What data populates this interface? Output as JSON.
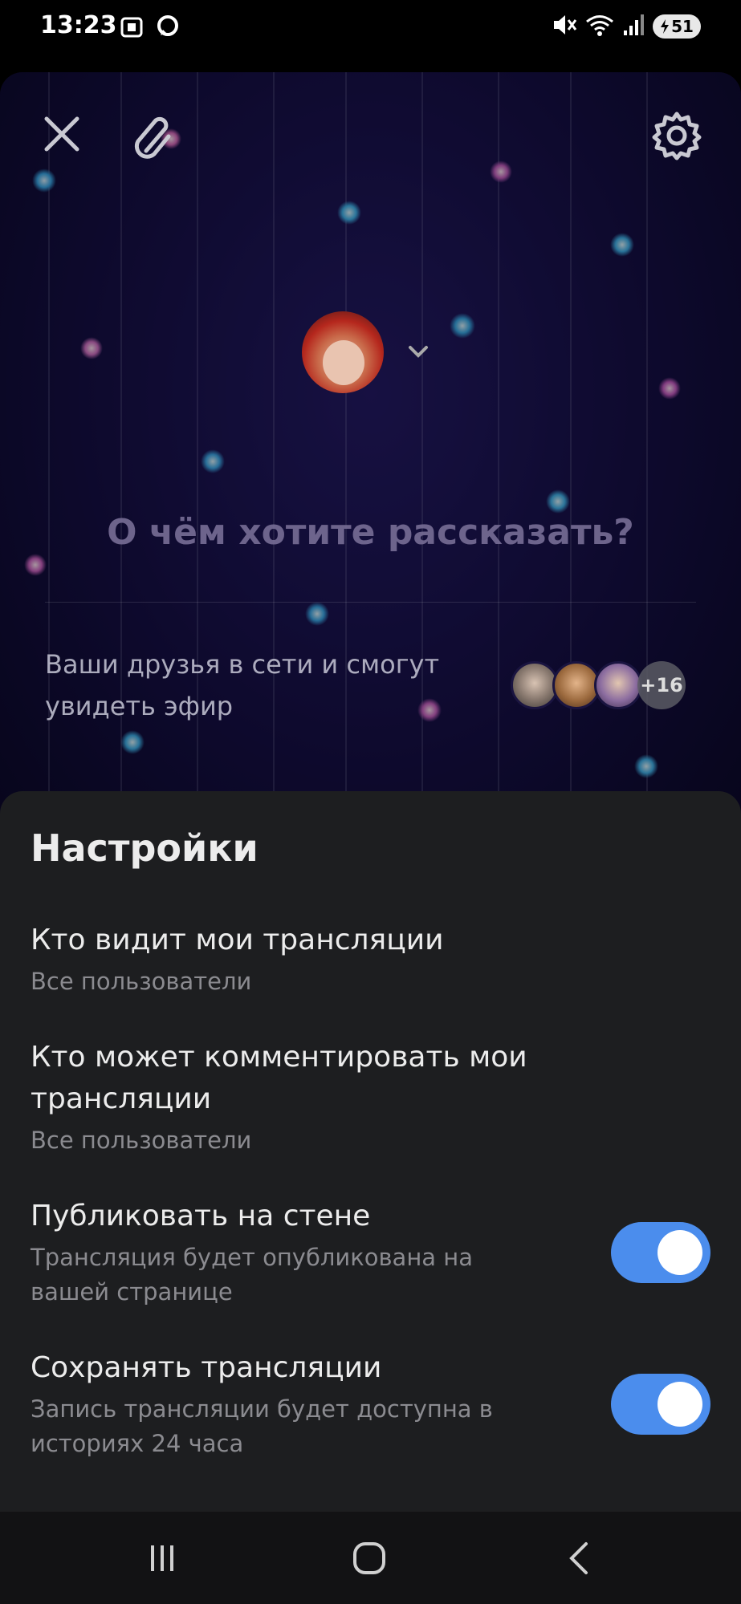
{
  "status_bar": {
    "time": "13:23",
    "battery": "51",
    "icons": [
      "screenshot-icon",
      "messenger-icon",
      "mute-icon",
      "wifi-icon",
      "signal-icon",
      "battery-icon"
    ]
  },
  "composer": {
    "placeholder": "О чём хотите рассказать?",
    "friends_text": "Ваши друзья в сети и смогут увидеть эфир",
    "friends_more": "+16",
    "icons": [
      "close-icon",
      "attach-icon",
      "settings-icon",
      "chevron-down-icon"
    ]
  },
  "settings": {
    "title": "Настройки",
    "options": [
      {
        "title": "Кто видит мои трансляции",
        "subtitle": "Все пользователи"
      },
      {
        "title": "Кто может комментировать мои трансляции",
        "subtitle": "Все пользователи"
      },
      {
        "title": "Публиковать на стене",
        "subtitle": "Трансляция будет опубликована на вашей странице",
        "enabled": true
      },
      {
        "title": "Сохранять трансляции",
        "subtitle": "Запись трансляции будет доступна в историях 24 часа",
        "enabled": true
      }
    ]
  },
  "colors": {
    "sheet_background": "#1d1e20",
    "toggle_on": "#4b8ded"
  }
}
